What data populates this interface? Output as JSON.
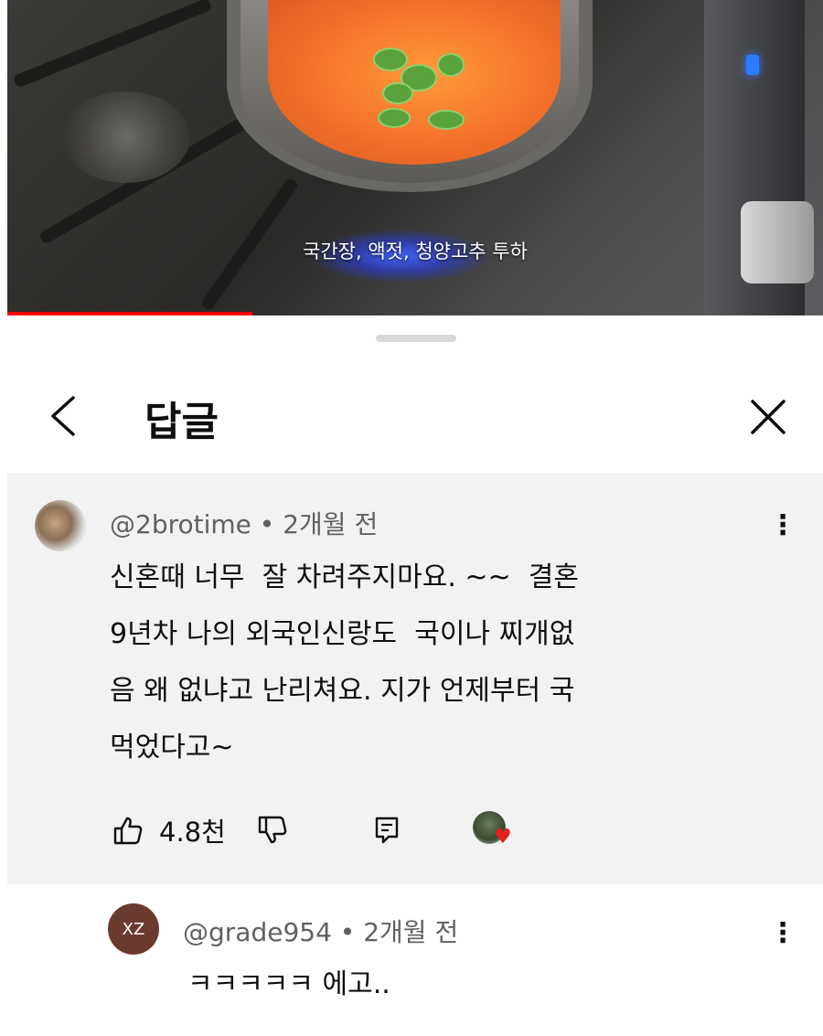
{
  "video": {
    "caption": "국간장, 액젓, 청양고추 투하",
    "progress_fraction": 0.3
  },
  "sheet": {
    "title": "답글"
  },
  "comment": {
    "author": "@2brotime",
    "time": "2개월 전",
    "lines": [
      "신혼때 너무  잘 차려주지마요. ~~  결혼",
      "9년차 나의 외국인신랑도  국이나 찌개없",
      "음 왜 없냐고 난리쳐요. 지가 언제부터 국",
      "먹었다고~"
    ],
    "likes": "4.8천"
  },
  "reply": {
    "avatar_initials": "XZ",
    "author": "@grade954",
    "time": "2개월 전",
    "text": "ㅋㅋㅋㅋㅋ 에고.."
  },
  "icons": {
    "back": "chevron-left-icon",
    "close": "close-icon",
    "menu": "kebab-menu-icon",
    "like": "thumbs-up-icon",
    "dislike": "thumbs-down-icon",
    "reply": "reply-icon",
    "creator_heart": "heart-icon"
  },
  "colors": {
    "progress": "#ff0000",
    "heart": "#e2231a",
    "reply_avatar": "#6b3a2e"
  }
}
